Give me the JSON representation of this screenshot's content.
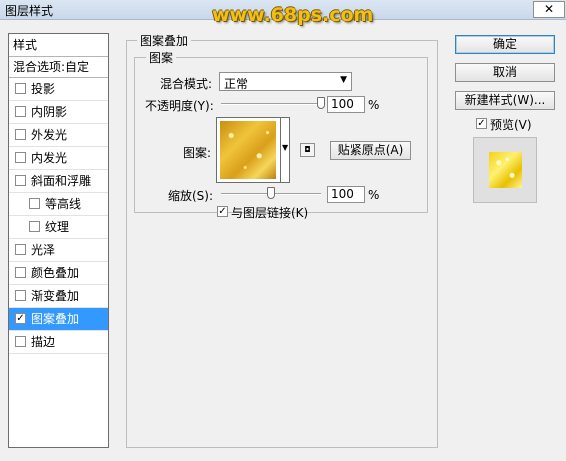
{
  "window": {
    "title": "图层样式",
    "watermark": "www.68ps.com",
    "close": "✕"
  },
  "sidebar": {
    "header": "样式",
    "blend_options": "混合选项:自定",
    "items": [
      {
        "label": "投影",
        "checked": false
      },
      {
        "label": "内阴影",
        "checked": false
      },
      {
        "label": "外发光",
        "checked": false
      },
      {
        "label": "内发光",
        "checked": false
      },
      {
        "label": "斜面和浮雕",
        "checked": false
      },
      {
        "label": "等高线",
        "checked": false
      },
      {
        "label": "纹理",
        "checked": false
      },
      {
        "label": "光泽",
        "checked": false
      },
      {
        "label": "颜色叠加",
        "checked": false
      },
      {
        "label": "渐变叠加",
        "checked": false
      },
      {
        "label": "图案叠加",
        "checked": true
      },
      {
        "label": "描边",
        "checked": false
      }
    ]
  },
  "panel": {
    "group_title": "图案叠加",
    "subgroup_title": "图案",
    "blend_mode_label": "混合模式:",
    "blend_mode_value": "正常",
    "opacity_label": "不透明度(Y):",
    "opacity_value": "100",
    "opacity_unit": "%",
    "pattern_label": "图案:",
    "snap_origin_button": "贴紧原点(A)",
    "scale_label": "缩放(S):",
    "scale_value": "100",
    "scale_unit": "%",
    "link_label": "与图层链接(K)",
    "link_checked": true
  },
  "buttons": {
    "ok": "确定",
    "cancel": "取消",
    "new_style": "新建样式(W)...",
    "preview_label": "预览(V)",
    "preview_checked": true
  },
  "sliders": {
    "opacity_fraction": 1.0,
    "scale_fraction": 0.5
  },
  "colors": {
    "selected": "#3399ff",
    "pattern": "#f0c43a"
  }
}
